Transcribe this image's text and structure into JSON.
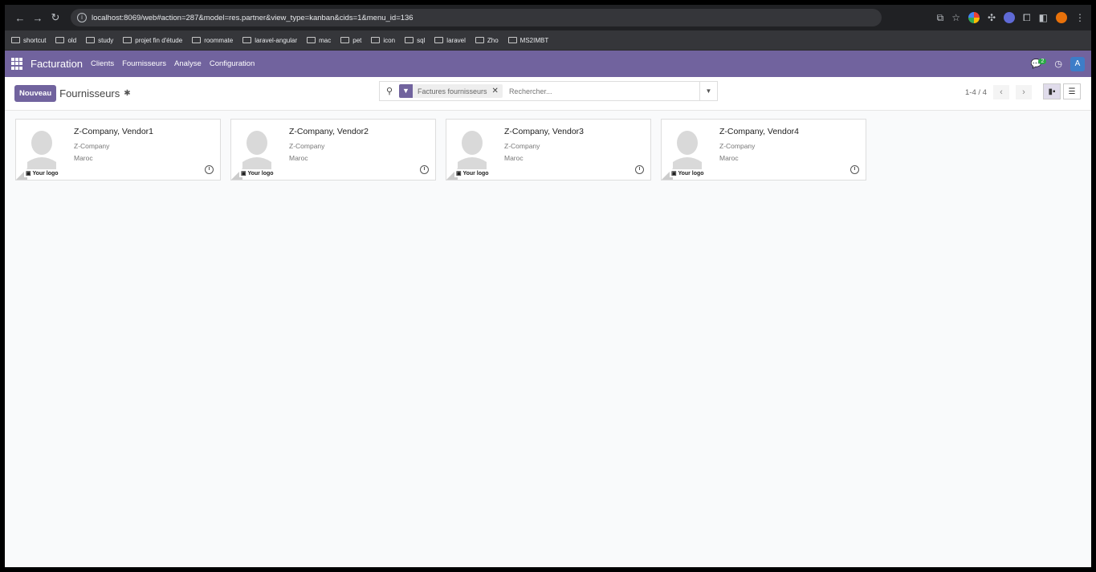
{
  "browser": {
    "url": "localhost:8069/web#action=287&model=res.partner&view_type=kanban&cids=1&menu_id=136",
    "bookmarks": [
      "shortcut",
      "old",
      "study",
      "projet fin d'étude",
      "roommate",
      "laravel-angular",
      "mac",
      "pet",
      "icon",
      "sql",
      "laravel",
      "Zho",
      "MS2IMBT"
    ]
  },
  "navbar": {
    "app_name": "Facturation",
    "menu": [
      "Clients",
      "Fournisseurs",
      "Analyse",
      "Configuration"
    ],
    "message_count": "2",
    "user_initial": "A",
    "accent": "#71639e"
  },
  "control_panel": {
    "new_label": "Nouveau",
    "title": "Fournisseurs",
    "facet_label": "Factures fournisseurs",
    "search_placeholder": "Rechercher...",
    "pager": "1-4 / 4"
  },
  "vendors": [
    {
      "name": "Z-Company, Vendor1",
      "company": "Z-Company",
      "country": "Maroc",
      "logo": "Your logo"
    },
    {
      "name": "Z-Company, Vendor2",
      "company": "Z-Company",
      "country": "Maroc",
      "logo": "Your logo"
    },
    {
      "name": "Z-Company, Vendor3",
      "company": "Z-Company",
      "country": "Maroc",
      "logo": "Your logo"
    },
    {
      "name": "Z-Company, Vendor4",
      "company": "Z-Company",
      "country": "Maroc",
      "logo": "Your logo"
    }
  ]
}
